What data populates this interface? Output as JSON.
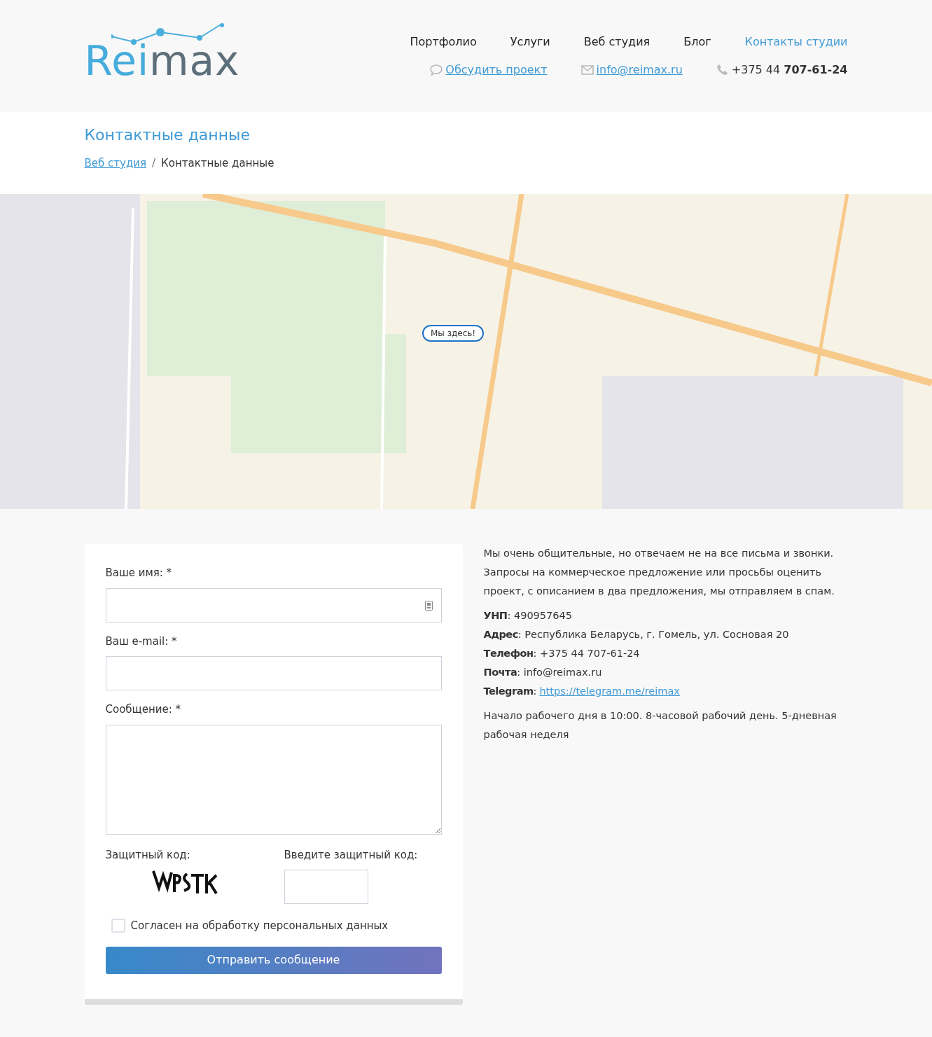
{
  "logo": {
    "text_primary": "Rei",
    "text_secondary": "max"
  },
  "nav": [
    {
      "label": "Портфолио",
      "selected": false
    },
    {
      "label": "Услуги",
      "selected": false
    },
    {
      "label": "Веб студия",
      "selected": false
    },
    {
      "label": "Блог",
      "selected": false
    },
    {
      "label": "Контакты студии",
      "selected": true
    }
  ],
  "contacts": [
    {
      "kind": "chat",
      "text": "Обсудить проект"
    },
    {
      "kind": "email",
      "text": "info@reimax.ru"
    },
    {
      "kind": "phone",
      "text": "+375 44 **707-61-24**"
    }
  ],
  "page_title": "Контактные данные",
  "breadcrumbs": [
    {
      "label": "Веб студия",
      "kind": "link"
    },
    {
      "label": "/",
      "kind": "separator"
    },
    {
      "label": "Контактные данные",
      "kind": "current"
    }
  ],
  "map": {
    "marker": "Мы здесь!"
  },
  "form": {
    "fields": [
      {
        "label": "Ваше имя: *",
        "kind": "input",
        "autofill_icon": true
      },
      {
        "label": "Ваш e-mail: *",
        "kind": "input",
        "autofill_icon": false
      },
      {
        "label": "Сообщение: *",
        "kind": "textarea"
      }
    ],
    "captcha_label": "Защитный код:",
    "captcha_input_label": "Введите защитный код:",
    "consent": {
      "label": "Согласен на обработку персональных данных",
      "checked": false
    },
    "submit": "Отправить сообщение"
  },
  "intro": "Мы очень общительные, но отвечаем не на все письма и звонки. Запросы на коммерческое предложение или просьбы оценить проект, с описанием в два предложения, мы отправляем в спам.",
  "info": [
    {
      "label": "УНП",
      "value": ": 490957645",
      "kind": "text"
    },
    {
      "label": "Адрес",
      "value": ": Республика Беларусь, г. Гомель, ул. Сосновая 20",
      "kind": "text"
    },
    {
      "label": "Телефон",
      "value": ": +375 44 707-61-24",
      "kind": "text"
    },
    {
      "label": "Почта",
      "value": ": info@reimax.ru",
      "kind": "text"
    },
    {
      "label": "Telegram",
      "prefix": ":",
      "value": "https://telegram.me/reimax",
      "kind": "link"
    }
  ],
  "hours": "Начало рабочего дня в 10:00. 8-часовой рабочий день. 5-дневная рабочая неделя"
}
